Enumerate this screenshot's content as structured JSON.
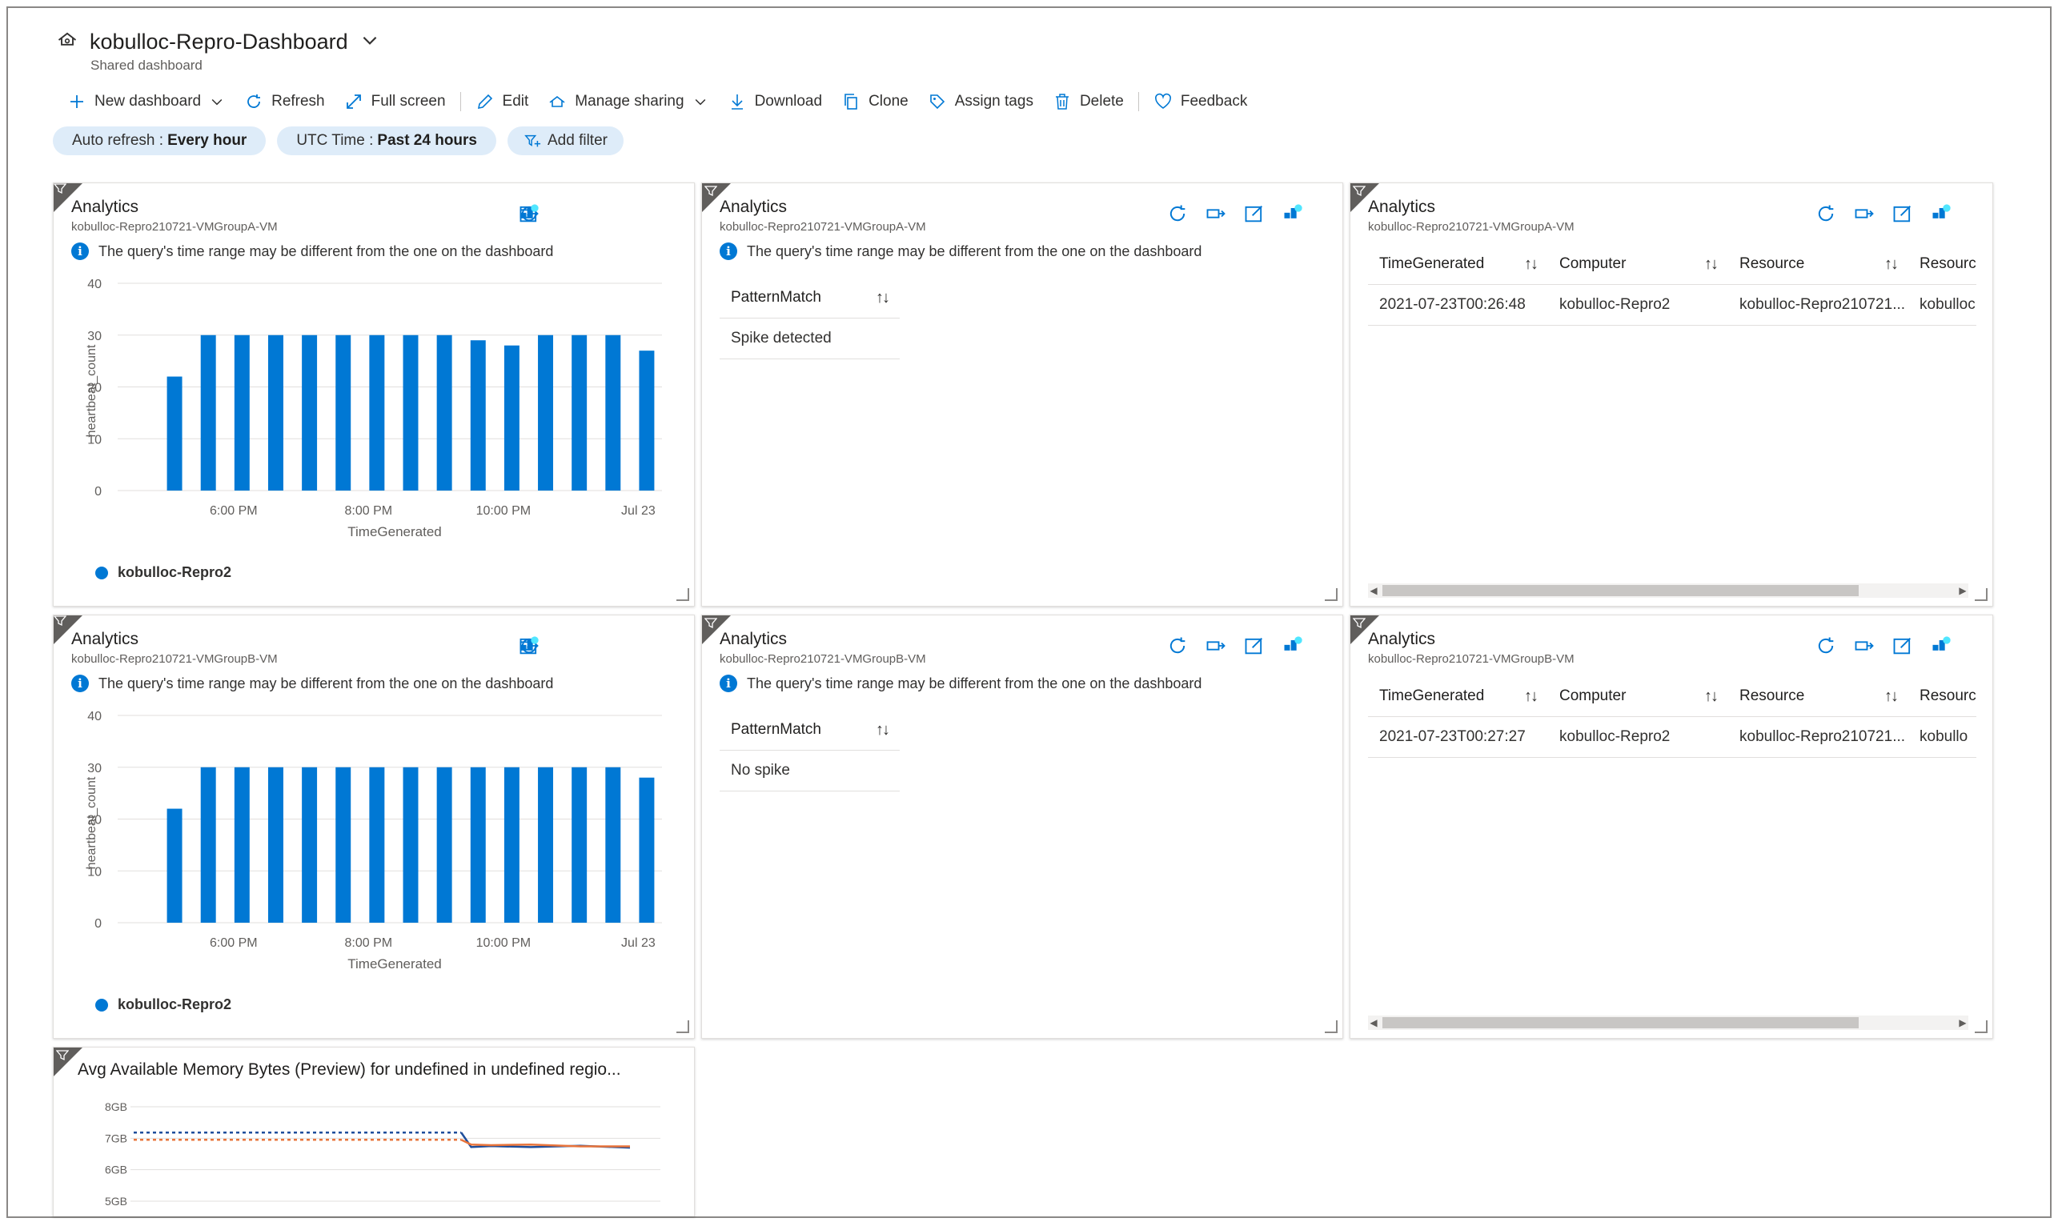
{
  "dashboard": {
    "title": "kobulloc-Repro-Dashboard",
    "subtitle": "Shared dashboard"
  },
  "toolbar": {
    "new_dashboard": "New dashboard",
    "refresh": "Refresh",
    "full_screen": "Full screen",
    "edit": "Edit",
    "manage_sharing": "Manage sharing",
    "download": "Download",
    "clone": "Clone",
    "assign_tags": "Assign tags",
    "delete": "Delete",
    "feedback": "Feedback"
  },
  "filters": {
    "auto_refresh_label": "Auto refresh :",
    "auto_refresh_value": "Every hour",
    "time_label": "UTC Time :",
    "time_value": "Past 24 hours",
    "add_filter": "Add filter"
  },
  "colors": {
    "accent": "#0078d4",
    "pill": "#deecf9",
    "memory_line_blue": "#1f4e9b",
    "memory_line_orange": "#e8743b"
  },
  "info_text": "The query's time range may be different from the one on the dashboard",
  "tiles": {
    "chart_a": {
      "title": "Analytics",
      "subtitle": "kobulloc-Repro210721-VMGroupA-VM",
      "legend": "kobulloc-Repro2"
    },
    "pattern_a": {
      "title": "Analytics",
      "subtitle": "kobulloc-Repro210721-VMGroupA-VM",
      "header": "PatternMatch",
      "value": "Spike detected"
    },
    "table_a": {
      "title": "Analytics",
      "subtitle": "kobulloc-Repro210721-VMGroupA-VM",
      "columns": [
        "TimeGenerated",
        "Computer",
        "Resource",
        "Resourc"
      ],
      "row": [
        "2021-07-23T00:26:48",
        "kobulloc-Repro2",
        "kobulloc-Repro210721...",
        "kobulloc"
      ]
    },
    "chart_b": {
      "title": "Analytics",
      "subtitle": "kobulloc-Repro210721-VMGroupB-VM",
      "legend": "kobulloc-Repro2"
    },
    "pattern_b": {
      "title": "Analytics",
      "subtitle": "kobulloc-Repro210721-VMGroupB-VM",
      "header": "PatternMatch",
      "value": "No spike"
    },
    "table_b": {
      "title": "Analytics",
      "subtitle": "kobulloc-Repro210721-VMGroupB-VM",
      "columns": [
        "TimeGenerated",
        "Computer",
        "Resource",
        "Resourc"
      ],
      "row": [
        "2021-07-23T00:27:27",
        "kobulloc-Repro2",
        "kobulloc-Repro210721...",
        "kobullo"
      ]
    },
    "memory": {
      "title": "Avg Available Memory Bytes (Preview) for undefined in undefined regio..."
    }
  },
  "chart_data": [
    {
      "type": "bar",
      "xlabel": "TimeGenerated",
      "ylabel": "heartbeat_count",
      "ylim": [
        0,
        40
      ],
      "yticks": [
        0,
        10,
        20,
        30,
        40
      ],
      "xticks": [
        "6:00 PM",
        "8:00 PM",
        "10:00 PM",
        "Jul 23"
      ],
      "xtick_positions": [
        2.25,
        6.25,
        10.25,
        14.25
      ],
      "series": [
        {
          "name": "kobulloc-Repro2",
          "values": [
            22,
            30,
            30,
            30,
            30,
            30,
            30,
            30,
            30,
            29,
            28,
            30,
            30,
            30,
            27
          ]
        }
      ]
    },
    {
      "type": "bar",
      "xlabel": "TimeGenerated",
      "ylabel": "heartbeat_count",
      "ylim": [
        0,
        40
      ],
      "yticks": [
        0,
        10,
        20,
        30,
        40
      ],
      "xticks": [
        "6:00 PM",
        "8:00 PM",
        "10:00 PM",
        "Jul 23"
      ],
      "xtick_positions": [
        2.25,
        6.25,
        10.25,
        14.25
      ],
      "series": [
        {
          "name": "kobulloc-Repro2",
          "values": [
            22,
            30,
            30,
            30,
            30,
            30,
            30,
            30,
            30,
            30,
            30,
            30,
            30,
            30,
            28
          ]
        }
      ]
    },
    {
      "type": "line",
      "title": "Avg Available Memory Bytes (Preview) for undefined in undefined regio...",
      "ylim": [
        5,
        8
      ],
      "yticks": [
        "5GB",
        "6GB",
        "7GB",
        "8GB"
      ],
      "series": [
        {
          "color": "#1f4e9b",
          "x": [
            0,
            0.66,
            0.68,
            0.72,
            0.8,
            0.9,
            1.0
          ],
          "y": [
            7.18,
            7.18,
            6.72,
            6.75,
            6.72,
            6.76,
            6.7
          ],
          "dashed_until": 0.66
        },
        {
          "color": "#e8743b",
          "x": [
            0,
            0.66,
            0.68,
            0.72,
            0.8,
            0.9,
            1.0
          ],
          "y": [
            6.95,
            6.95,
            6.8,
            6.78,
            6.8,
            6.74,
            6.74
          ],
          "dashed_until": 0.66
        }
      ]
    }
  ]
}
